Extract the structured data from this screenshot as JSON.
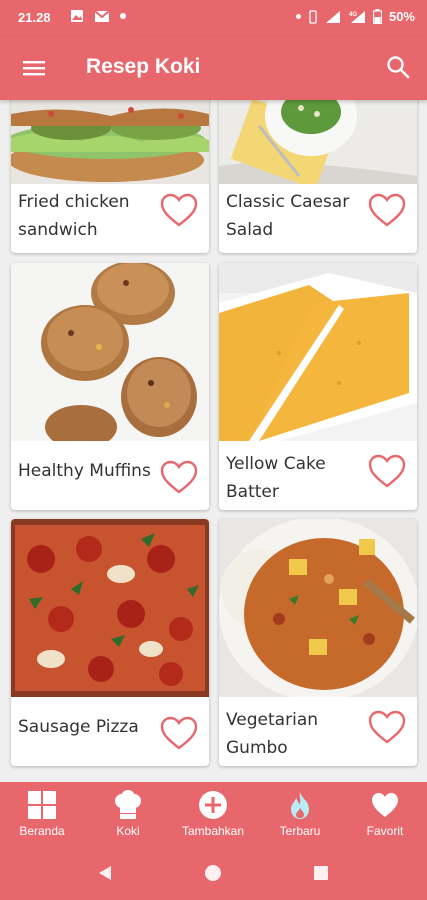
{
  "status_bar": {
    "time": "21.28",
    "battery": "50%",
    "network": "4G",
    "icons": [
      "gallery-icon",
      "gmail-icon",
      "dot-icon",
      "dot-icon",
      "vibrate-icon",
      "wifi-icon",
      "signal-icon",
      "battery-icon"
    ]
  },
  "appbar": {
    "title": "Resep Koki",
    "menu_icon": "hamburger-menu-icon",
    "search_icon": "search-icon"
  },
  "recipes": [
    {
      "name": "Fried chicken sandwich",
      "favorite": false
    },
    {
      "name": "Classic Caesar Salad",
      "favorite": false
    },
    {
      "name": "Healthy Muffins",
      "favorite": false
    },
    {
      "name": "Yellow Cake Batter",
      "favorite": false
    },
    {
      "name": "Sausage Pizza",
      "favorite": false
    },
    {
      "name": "Vegetarian Gumbo",
      "favorite": false
    }
  ],
  "bottom_nav": {
    "items": [
      {
        "label": "Beranda",
        "icon": "grid-icon"
      },
      {
        "label": "Koki",
        "icon": "chef-hat-icon"
      },
      {
        "label": "Tambahkan",
        "icon": "add-circle-icon"
      },
      {
        "label": "Terbaru",
        "icon": "flame-icon"
      },
      {
        "label": "Favorit",
        "icon": "heart-icon"
      }
    ],
    "active_index": 3
  },
  "colors": {
    "primary": "#e8676c",
    "heart_outline": "#e8676c",
    "active_icon": "#b7ecf2"
  }
}
